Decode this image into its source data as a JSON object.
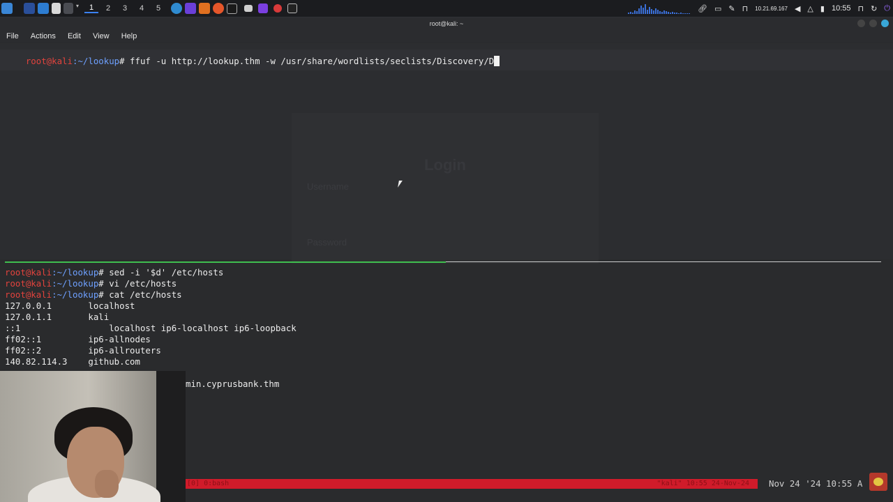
{
  "panel": {
    "workspaces": [
      "1",
      "2",
      "3",
      "4",
      "5"
    ],
    "active_workspace": 0,
    "ip": "10.21.69.167",
    "time": "10:55",
    "icons": [
      "kali-menu-icon",
      "desktop-icon",
      "file-manager-icon",
      "text-editor-icon",
      "screenshot-icon",
      "dropdown-icon",
      "burp-icon",
      "flameshot-icon",
      "burpsuite-icon",
      "firefox-icon",
      "terminal-icon",
      "window-icon",
      "app-icon",
      "app-icon-2",
      "terminal-app-icon"
    ],
    "tray_icons": [
      "paperclip-icon",
      "display-icon",
      "pen-icon",
      "lock-icon",
      "volume-icon",
      "bell-icon",
      "battery-icon",
      "lock-screen-icon",
      "refresh-icon",
      "power-icon"
    ]
  },
  "window": {
    "title": "root@kali: ~",
    "menu": [
      "File",
      "Actions",
      "Edit",
      "View",
      "Help"
    ]
  },
  "top_pane": {
    "prompt_user": "root@kali",
    "prompt_path": ":~/lookup",
    "prompt_symbol": "# ",
    "command": "ffuf -u http://lookup.thm -w /usr/share/wordlists/seclists/Discovery/D",
    "ghost_title": "Login",
    "ghost_username": "Username",
    "ghost_password": "Password"
  },
  "bottom_pane": {
    "lines": [
      {
        "type": "prompt",
        "user": "root@kali",
        "path": ":~/lookup",
        "symbol": "# ",
        "text": "sed -i '$d' /etc/hosts"
      },
      {
        "type": "prompt",
        "user": "root@kali",
        "path": ":~/lookup",
        "symbol": "# ",
        "text": "vi /etc/hosts"
      },
      {
        "type": "prompt",
        "user": "root@kali",
        "path": ":~/lookup",
        "symbol": "# ",
        "text": "cat /etc/hosts"
      },
      {
        "type": "out",
        "text": "127.0.0.1       localhost"
      },
      {
        "type": "out",
        "text": "127.0.1.1       kali"
      },
      {
        "type": "out",
        "text": "::1                 localhost ip6-localhost ip6-loopback"
      },
      {
        "type": "out",
        "text": "ff02::1         ip6-allnodes"
      },
      {
        "type": "out",
        "text": "ff02::2         ip6-allrouters"
      },
      {
        "type": "out",
        "text": "140.82.114.3    github.com"
      }
    ],
    "partial_line": "min.cyprusbank.thm"
  },
  "statusbar": {
    "left": "[0] 0:bash",
    "right": "\"kali\" 10:55 24-Nov-24"
  },
  "clock": "Nov 24 '24 10:55 A",
  "colors": {
    "prompt_user": "#e3433d",
    "prompt_path": "#6ea0ff",
    "divider_active": "#3fbf4f",
    "statusbar": "#d01b2a"
  }
}
